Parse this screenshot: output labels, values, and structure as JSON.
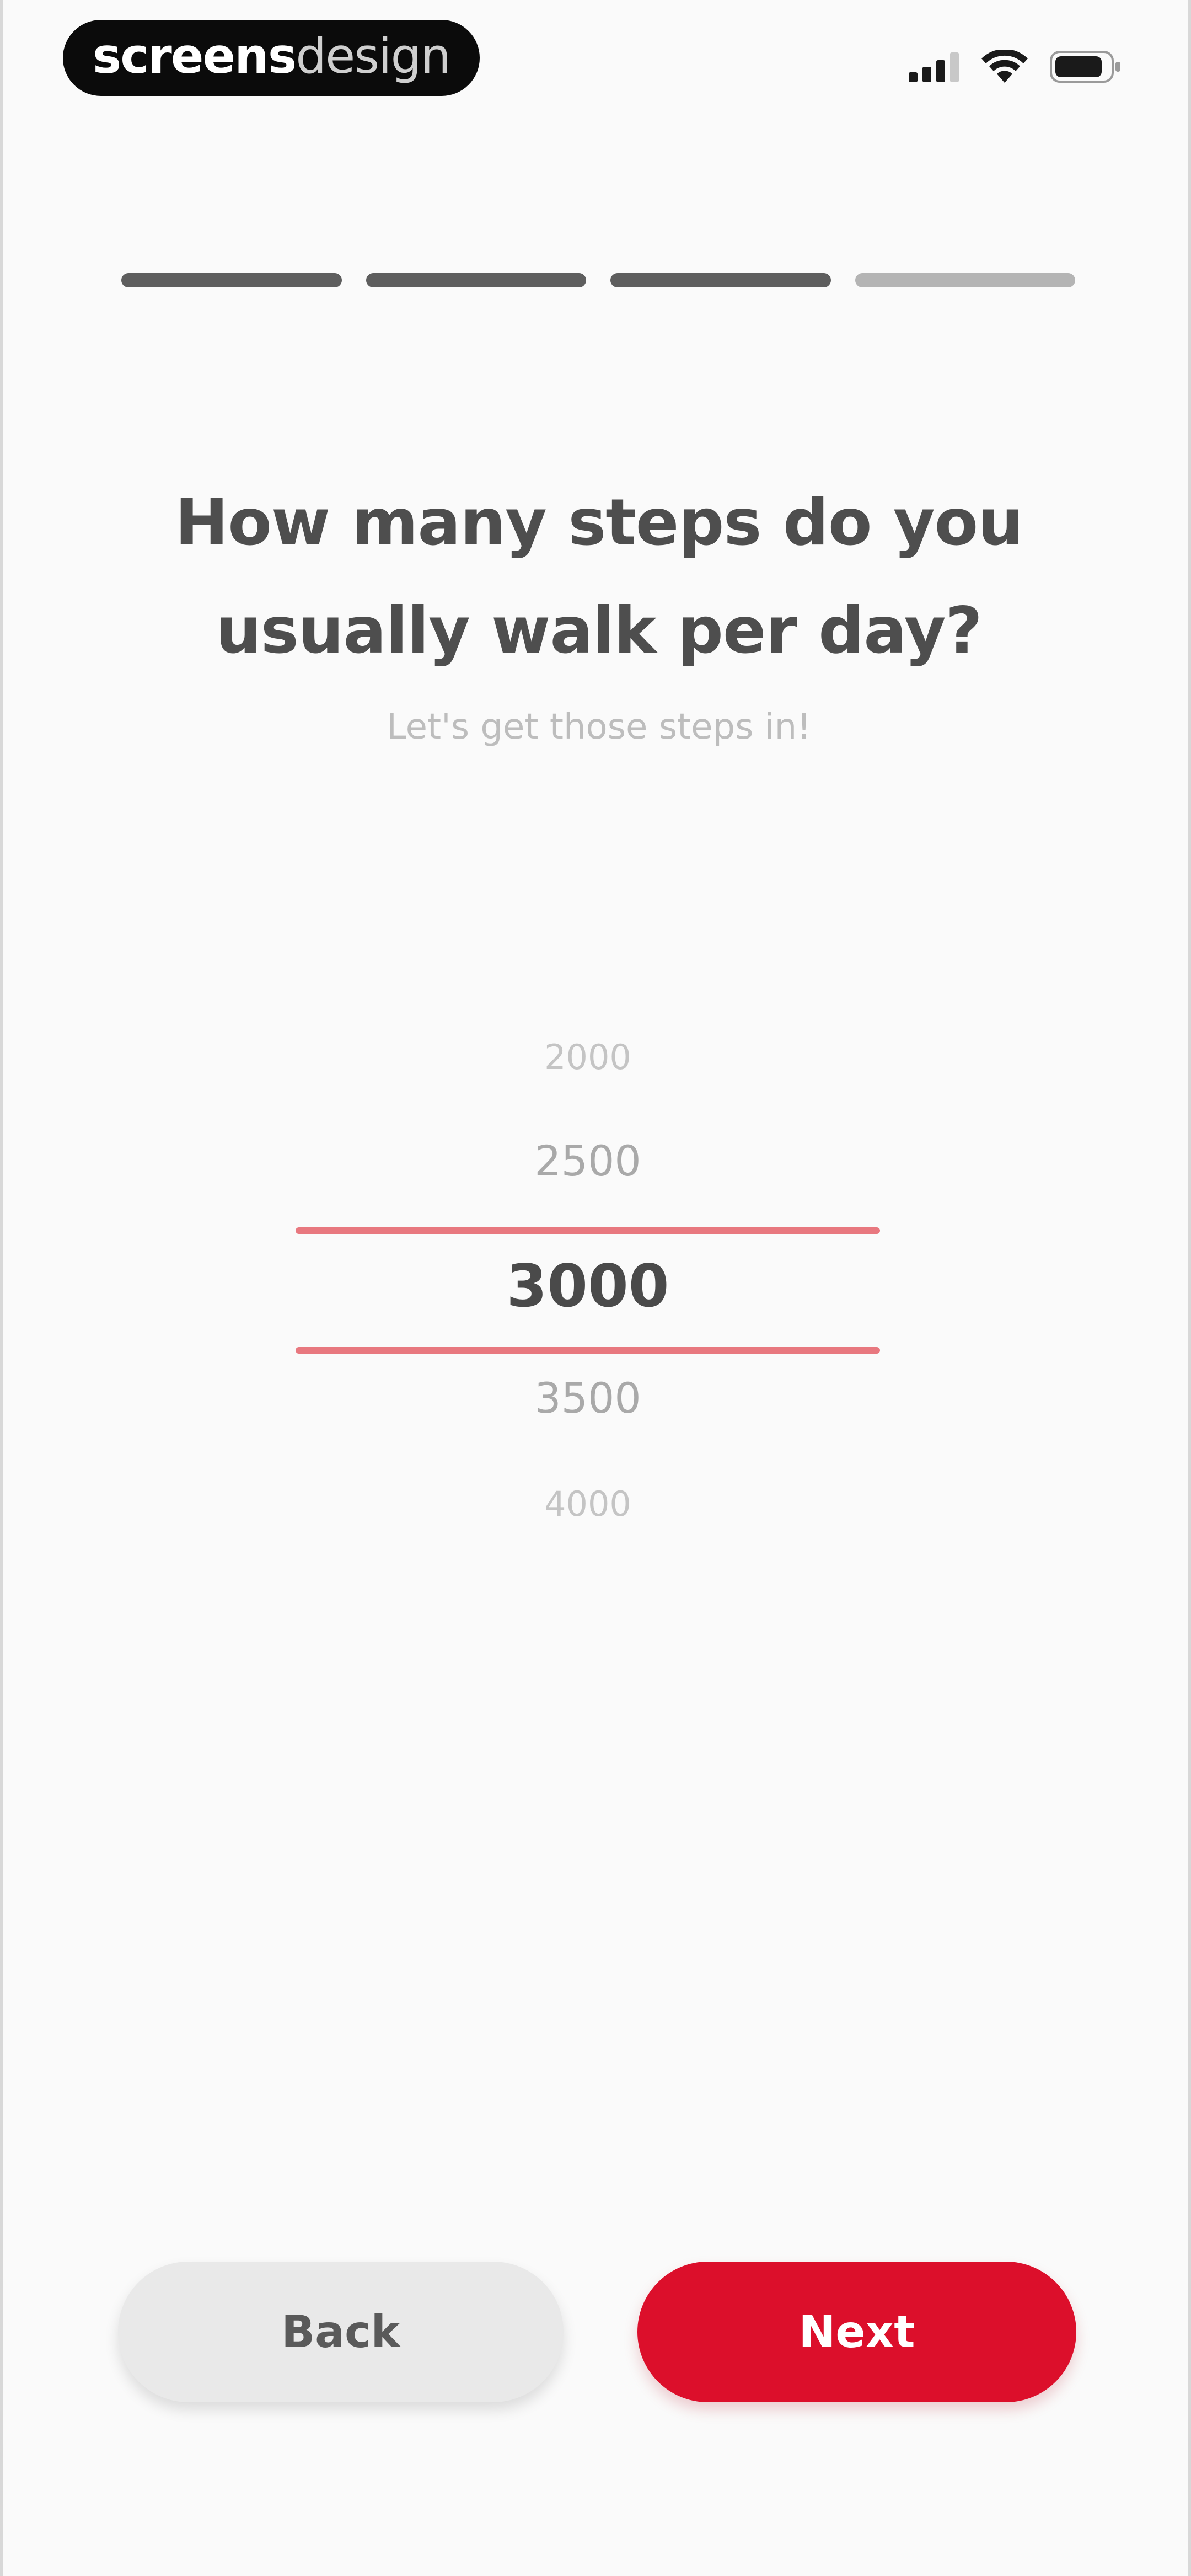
{
  "status_bar": {
    "logo": {
      "strong": "screens",
      "light": "design"
    },
    "icons": [
      "signal-icon",
      "wifi-icon",
      "battery-icon"
    ]
  },
  "progress": {
    "total_steps": 4,
    "completed_steps": 3
  },
  "question": {
    "title_line1": "How many steps do you",
    "title_line2": "usually walk per day?",
    "subtitle": "Let's get those steps in!"
  },
  "picker": {
    "options": [
      "2000",
      "2500",
      "3000",
      "3500",
      "4000"
    ],
    "selected": "3000"
  },
  "buttons": {
    "back_label": "Back",
    "next_label": "Next"
  },
  "colors": {
    "accent": "#dc0f2b",
    "picker_line": "#e8787f",
    "progress_active": "#5e5e5e",
    "progress_inactive": "#b4b4b4",
    "background": "#fafafa"
  }
}
